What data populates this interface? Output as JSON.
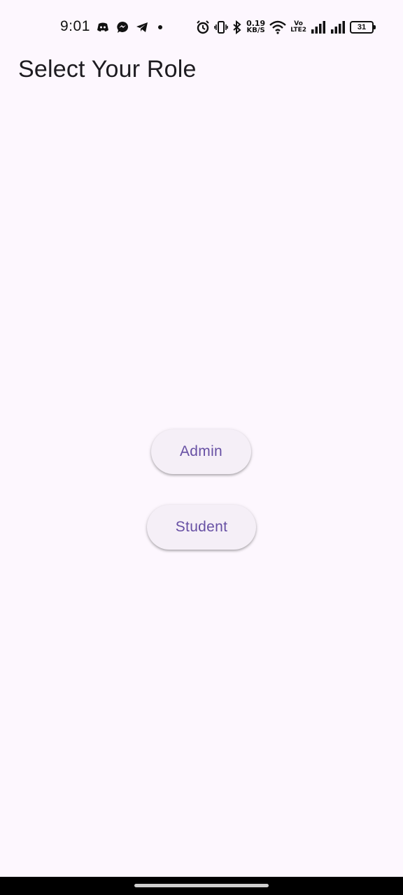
{
  "status_bar": {
    "time": "9:01",
    "left_icons": [
      "discord-icon",
      "messenger-icon",
      "telegram-icon",
      "dot-icon"
    ],
    "right_icons": [
      "alarm-icon",
      "vibrate-icon",
      "bluetooth-icon",
      "network-speed",
      "wifi-icon",
      "volte-icon",
      "signal-icon",
      "signal-icon",
      "battery-icon"
    ],
    "network_speed_value": "0.19",
    "network_speed_unit": "KB/S",
    "volte_line1": "Vo",
    "volte_line2": "LTE2",
    "battery_level": "31"
  },
  "app_bar": {
    "title": "Select Your Role"
  },
  "roles": {
    "admin_label": "Admin",
    "student_label": "Student"
  },
  "colors": {
    "background": "#fdf7fe",
    "button_bg": "#f5eff7",
    "button_text": "#6750a4",
    "title_text": "#1d1b20"
  }
}
